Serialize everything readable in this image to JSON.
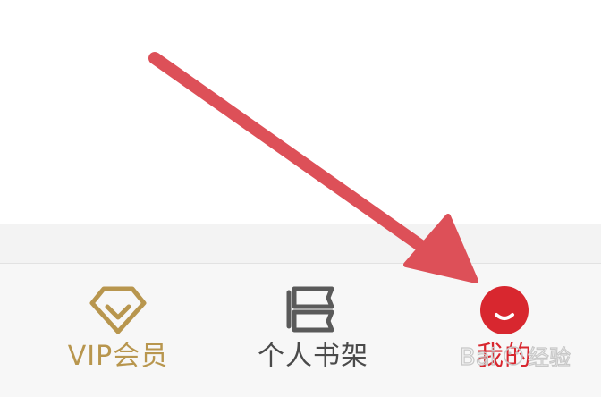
{
  "tabbar": {
    "tabs": [
      {
        "id": "vip",
        "label": "VIP会员",
        "icon": "diamond-icon",
        "color": "#b8964e"
      },
      {
        "id": "shelf",
        "label": "个人书架",
        "icon": "bookshelf-icon",
        "color": "#4a4a4a"
      },
      {
        "id": "mine",
        "label": "我的",
        "icon": "smiley-avatar-icon",
        "color": "#d8272f",
        "active": true
      }
    ]
  },
  "annotation": {
    "icon": "arrow-pointer-icon",
    "color": "#dd5058"
  },
  "watermark": {
    "text": "Bai经验",
    "color": "#c8c8c8"
  }
}
